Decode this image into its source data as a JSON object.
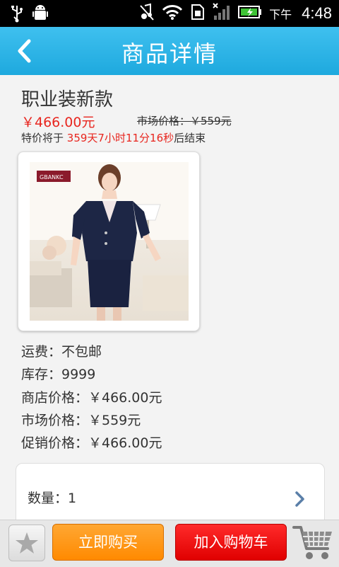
{
  "status_bar": {
    "ampm": "下午",
    "time": "4:48"
  },
  "header": {
    "title": "商品详情"
  },
  "product": {
    "name": "职业装新款",
    "price": "￥466.00元",
    "market_price": "市场价格：￥559元",
    "countdown_prefix": "特价将于",
    "countdown_time": "359天7小时11分16秒",
    "countdown_suffix": "后结束",
    "photo_brand": "GBANKC"
  },
  "details": {
    "shipping": "运费：不包邮",
    "stock": "库存：9999",
    "store_price": "商店价格：￥466.00元",
    "market_price": "市场价格：￥559元",
    "promo_price": "促销价格：￥466.00元"
  },
  "quantity": {
    "label": "数量：1"
  },
  "bottom_bar": {
    "buy_now": "立即购买",
    "add_to_cart": "加入购物车"
  },
  "colors": {
    "header_blue": "#1ea9de",
    "price_red": "#e8261f",
    "buy_orange": "#ff8a00",
    "cart_red": "#e00000"
  },
  "icons": [
    "usb-icon",
    "android-debug-icon",
    "mute-icon",
    "wifi-icon",
    "sim-icon",
    "signal-icon",
    "battery-icon",
    "back-arrow-icon",
    "chevron-right-icon",
    "star-icon",
    "shopping-cart-icon"
  ]
}
